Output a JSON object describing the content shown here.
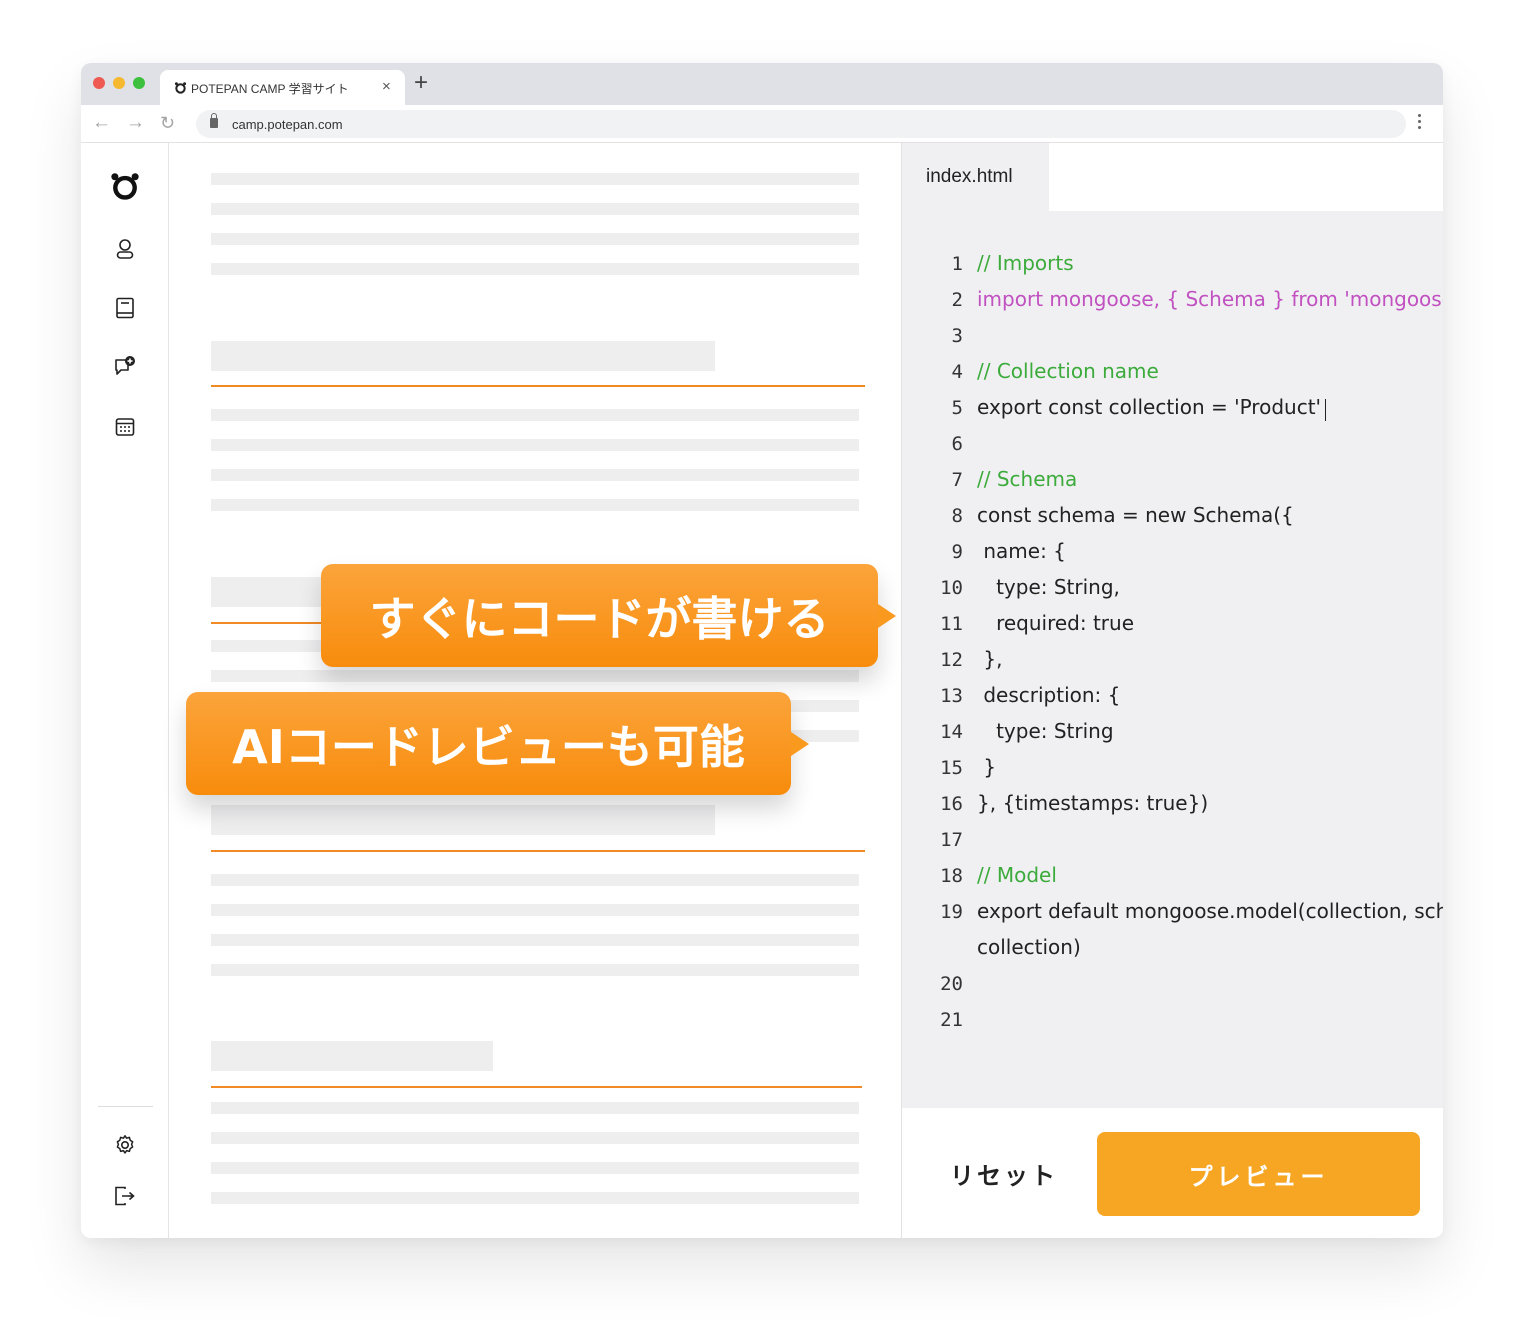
{
  "browser": {
    "tab_title": "POTEPAN CAMP 学習サイト",
    "tab_close": "×",
    "new_tab": "+",
    "url": "camp.potepan.com",
    "back": "←",
    "forward": "→",
    "reload": "↻"
  },
  "sidebar": {
    "items": [
      {
        "icon": "potepan-logo-icon"
      },
      {
        "icon": "user-icon"
      },
      {
        "icon": "book-icon"
      },
      {
        "icon": "chat-add-icon"
      },
      {
        "icon": "calendar-icon"
      }
    ],
    "bottom_items": [
      {
        "icon": "gear-icon"
      },
      {
        "icon": "logout-icon"
      }
    ]
  },
  "editor": {
    "filename": "index.html",
    "lines": [
      {
        "n": "1",
        "text": "// Imports",
        "style": "comment"
      },
      {
        "n": "2",
        "text": "import mongoose, { Schema } from 'mongoose'",
        "style": "keyword"
      },
      {
        "n": "3",
        "text": "",
        "style": "plain"
      },
      {
        "n": "4",
        "text": "// Collection name",
        "style": "comment"
      },
      {
        "n": "5",
        "text": "export const collection = 'Product'",
        "style": "plain",
        "caret": true
      },
      {
        "n": "6",
        "text": "",
        "style": "plain"
      },
      {
        "n": "7",
        "text": "// Schema",
        "style": "comment"
      },
      {
        "n": "8",
        "text": "const schema = new Schema({",
        "style": "plain"
      },
      {
        "n": "9",
        "text": " name: {",
        "style": "plain"
      },
      {
        "n": "10",
        "text": "   type: String,",
        "style": "plain"
      },
      {
        "n": "11",
        "text": "   required: true",
        "style": "plain"
      },
      {
        "n": "12",
        "text": " },",
        "style": "plain"
      },
      {
        "n": "13",
        "text": " description: {",
        "style": "plain"
      },
      {
        "n": "14",
        "text": "   type: String",
        "style": "plain"
      },
      {
        "n": "15",
        "text": " }",
        "style": "plain"
      },
      {
        "n": "16",
        "text": "}, {timestamps: true})",
        "style": "plain"
      },
      {
        "n": "17",
        "text": "",
        "style": "plain"
      },
      {
        "n": "18",
        "text": "// Model",
        "style": "comment"
      },
      {
        "n": "19",
        "text": "export default mongoose.model(collection, schema,",
        "style": "plain"
      },
      {
        "n": "",
        "text": "collection)",
        "style": "plain"
      },
      {
        "n": "20",
        "text": "",
        "style": "plain"
      },
      {
        "n": "21",
        "text": "",
        "style": "plain"
      }
    ],
    "reset_label": "リセット",
    "preview_label": "プレビュー"
  },
  "callouts": {
    "first": "すぐにコードが書ける",
    "second": "AIコードレビューも可能"
  },
  "colors": {
    "accent": "#f6a623",
    "rule": "#f08a24",
    "comment": "#3cab3c",
    "keyword": "#c150c1"
  }
}
